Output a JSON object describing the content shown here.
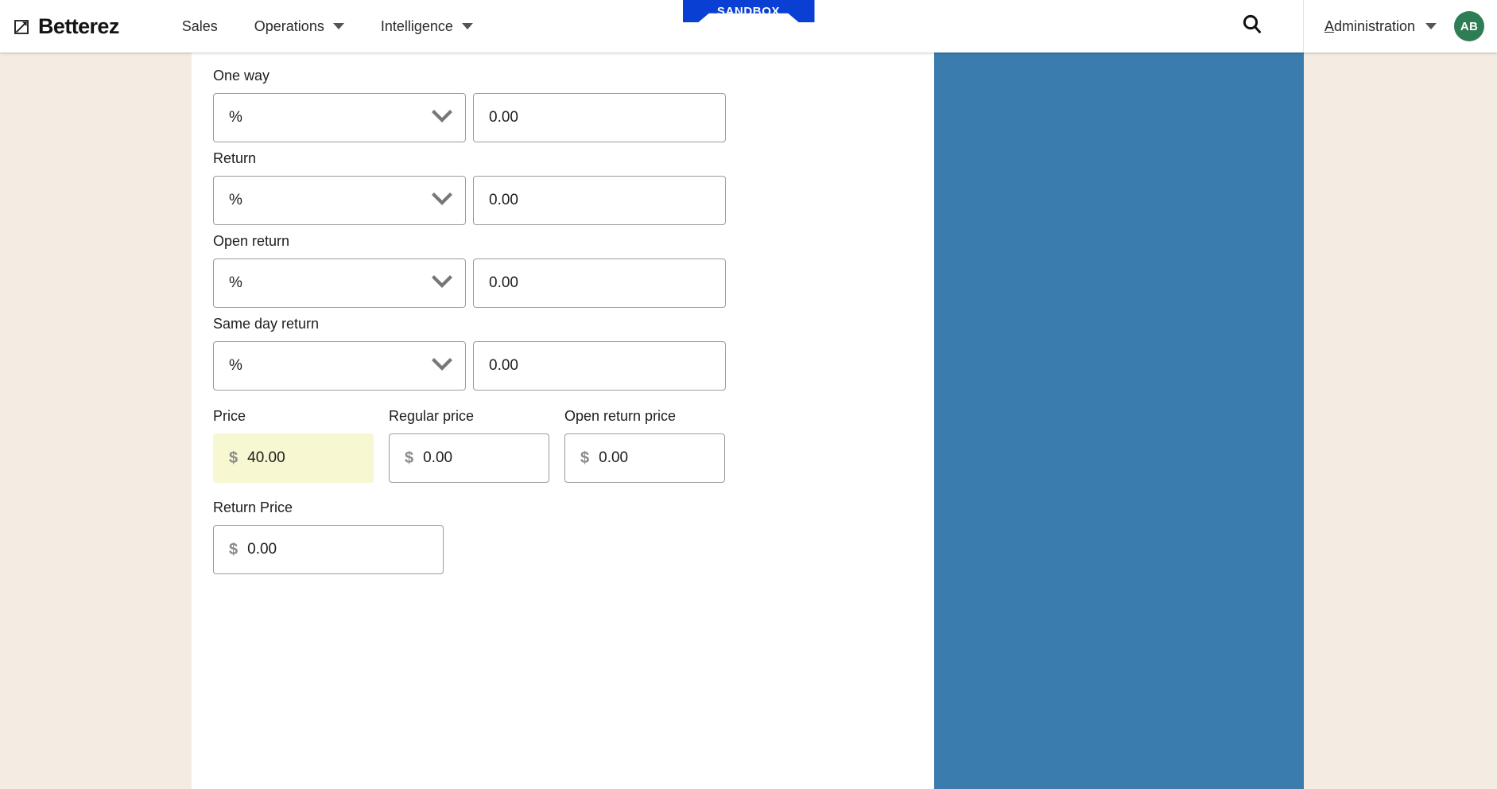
{
  "header": {
    "brand": "Betterez",
    "logo_icon": "betterez-arrow-logo",
    "nav": [
      {
        "label": "Sales",
        "has_caret": false
      },
      {
        "label": "Operations",
        "has_caret": true
      },
      {
        "label": "Intelligence",
        "has_caret": true
      }
    ],
    "search_icon": "search-icon",
    "admin": {
      "accesskey": "A",
      "label_rest": "dministration",
      "caret_icon": "chevron-down-icon"
    },
    "avatar_initials": "AB",
    "avatar_color": "#2e7d54"
  },
  "sandbox_banner": {
    "label": "SANDBOX",
    "color": "#0a3fd4"
  },
  "colors": {
    "page_background": "#f4ece3",
    "content_background": "#ffffff",
    "side_panel": "#3a7cad",
    "highlight_field": "#f7f7d2",
    "field_border": "#9b9b9b"
  },
  "form": {
    "discount_fields": [
      {
        "label": "One way",
        "unit_value": "%",
        "unit_icon": "chevron-down-icon",
        "amount_value": "0.00"
      },
      {
        "label": "Return",
        "unit_value": "%",
        "unit_icon": "chevron-down-icon",
        "amount_value": "0.00"
      },
      {
        "label": "Open return",
        "unit_value": "%",
        "unit_icon": "chevron-down-icon",
        "amount_value": "0.00"
      },
      {
        "label": "Same day return",
        "unit_value": "%",
        "unit_icon": "chevron-down-icon",
        "amount_value": "0.00"
      }
    ],
    "price_fields": [
      {
        "label": "Price",
        "currency_symbol": "$",
        "value": "40.00",
        "highlighted": true
      },
      {
        "label": "Regular price",
        "currency_symbol": "$",
        "value": "0.00",
        "highlighted": false
      },
      {
        "label": "Open return price",
        "currency_symbol": "$",
        "value": "0.00",
        "highlighted": false
      }
    ],
    "return_price": {
      "label": "Return Price",
      "currency_symbol": "$",
      "value": "0.00"
    }
  }
}
